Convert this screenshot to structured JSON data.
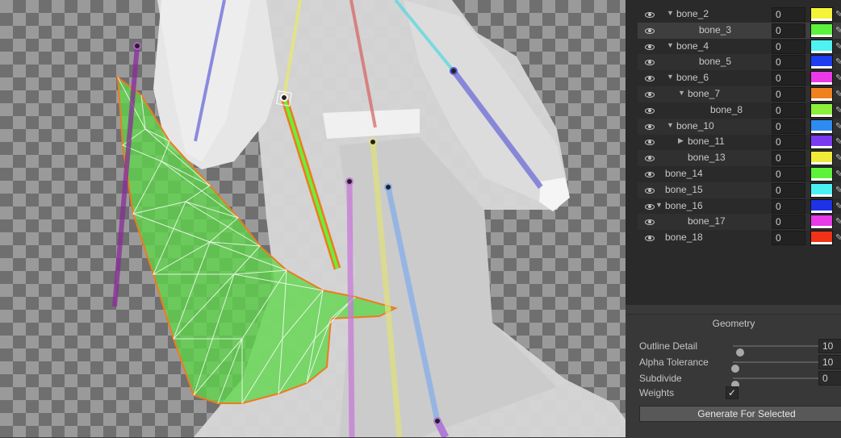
{
  "bones": [
    {
      "name": "bone_2",
      "depth": "0",
      "color": "#f4f43a",
      "indent": 1,
      "arrow": "down"
    },
    {
      "name": "bone_3",
      "depth": "0",
      "color": "#5cf23c",
      "indent": 3,
      "arrow": "none"
    },
    {
      "name": "bone_4",
      "depth": "0",
      "color": "#4ff2f2",
      "indent": 1,
      "arrow": "down"
    },
    {
      "name": "bone_5",
      "depth": "0",
      "color": "#1e3cf0",
      "indent": 3,
      "arrow": "none"
    },
    {
      "name": "bone_6",
      "depth": "0",
      "color": "#ea3ae8",
      "indent": 1,
      "arrow": "down"
    },
    {
      "name": "bone_7",
      "depth": "0",
      "color": "#f0821e",
      "indent": 2,
      "arrow": "down"
    },
    {
      "name": "bone_8",
      "depth": "0",
      "color": "#8cf03a",
      "indent": 4,
      "arrow": "none"
    },
    {
      "name": "bone_10",
      "depth": "0",
      "color": "#2e8cf0",
      "indent": 1,
      "arrow": "down"
    },
    {
      "name": "bone_11",
      "depth": "0",
      "color": "#7a3af0",
      "indent": 2,
      "arrow": "right"
    },
    {
      "name": "bone_13",
      "depth": "0",
      "color": "#f2ea3a",
      "indent": 2,
      "arrow": "none"
    },
    {
      "name": "bone_14",
      "depth": "0",
      "color": "#5ef23a",
      "indent": 0,
      "arrow": "none"
    },
    {
      "name": "bone_15",
      "depth": "0",
      "color": "#4af0f4",
      "indent": 0,
      "arrow": "none"
    },
    {
      "name": "bone_16",
      "depth": "0",
      "color": "#1e32e8",
      "indent": 0,
      "arrow": "down"
    },
    {
      "name": "bone_17",
      "depth": "0",
      "color": "#e83ae6",
      "indent": 2,
      "arrow": "none"
    },
    {
      "name": "bone_18",
      "depth": "0",
      "color": "#f03218",
      "indent": 0,
      "arrow": "none"
    }
  ],
  "geometry": {
    "title": "Geometry",
    "outline_detail": {
      "label": "Outline Detail",
      "value": "10",
      "slider_fraction": 0.06
    },
    "alpha_tolerance": {
      "label": "Alpha Tolerance",
      "value": "10",
      "slider_fraction": 0.0
    },
    "subdivide": {
      "label": "Subdivide",
      "value": "0",
      "slider_fraction": 0.0
    },
    "weights": {
      "label": "Weights",
      "checked": true,
      "check_glyph": "✓"
    },
    "generate_button": "Generate For Selected"
  },
  "colors": {
    "mesh_fill": "#5fd64a",
    "mesh_outline": "#f07a1e",
    "selected_bone": "#6af03a"
  },
  "icons": {
    "visibility": "eye-icon",
    "expand": "triangle-down-icon",
    "collapse": "triangle-right-icon",
    "edit": "pen-icon"
  }
}
